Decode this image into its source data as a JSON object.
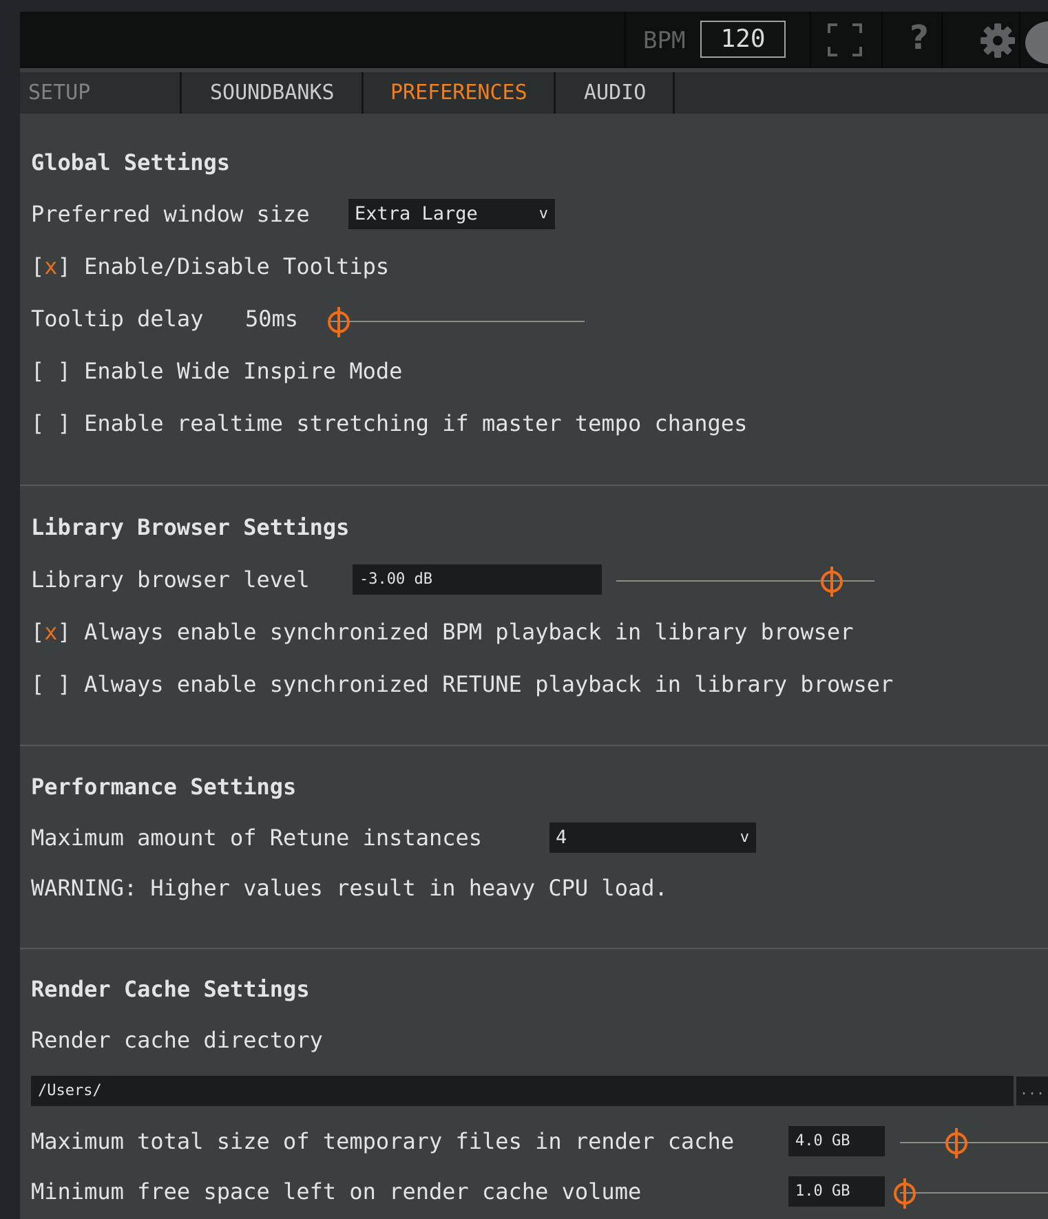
{
  "header": {
    "bpm_label": "BPM",
    "bpm_value": "120",
    "help_label": "?"
  },
  "tabs": [
    {
      "label": "SETUP"
    },
    {
      "label": "SOUNDBANKS"
    },
    {
      "label": "PREFERENCES",
      "active": true
    },
    {
      "label": "AUDIO"
    }
  ],
  "colors": {
    "accent": "#f07f1d",
    "panel": "#3b3f40",
    "header": "#0e0f0f"
  },
  "global": {
    "title": "Global Settings",
    "window_size_label": "Preferred window size",
    "window_size_value": "Extra Large",
    "caret": "v",
    "tooltips": {
      "checked": true,
      "mark": "x",
      "label": "Enable/Disable Tooltips"
    },
    "tooltip_delay_label": "Tooltip delay",
    "tooltip_delay_value": "50ms",
    "tooltip_delay_fraction": 0.03,
    "wide_inspire": {
      "checked": false,
      "mark": " ",
      "label": "Enable Wide Inspire Mode"
    },
    "realtime_stretch": {
      "checked": false,
      "mark": " ",
      "label": "Enable realtime stretching if master tempo changes"
    }
  },
  "library": {
    "title": "Library Browser Settings",
    "level_label": "Library browser level",
    "level_value": "-3.00 dB",
    "level_fraction": 0.83,
    "bpm_sync": {
      "checked": true,
      "mark": "x",
      "label": "Always enable synchronized BPM playback in library browser"
    },
    "retune_sync": {
      "checked": false,
      "mark": " ",
      "label": "Always enable synchronized RETUNE playback in library browser"
    }
  },
  "performance": {
    "title": "Performance Settings",
    "retune_label": "Maximum amount of Retune instances",
    "retune_value": "4",
    "warning": "WARNING: Higher values result in heavy CPU load."
  },
  "render_cache": {
    "title": "Render Cache Settings",
    "directory_label": "Render cache directory",
    "directory_value": "/Users/",
    "browse_label": "...",
    "max_size_label": "Maximum total size of temporary files in render cache",
    "max_size_value": "4.0 GB",
    "max_size_fraction": 0.3,
    "min_free_label": "Minimum free space left on render cache volume",
    "min_free_value": "1.0 GB",
    "min_free_fraction": 0.02
  }
}
